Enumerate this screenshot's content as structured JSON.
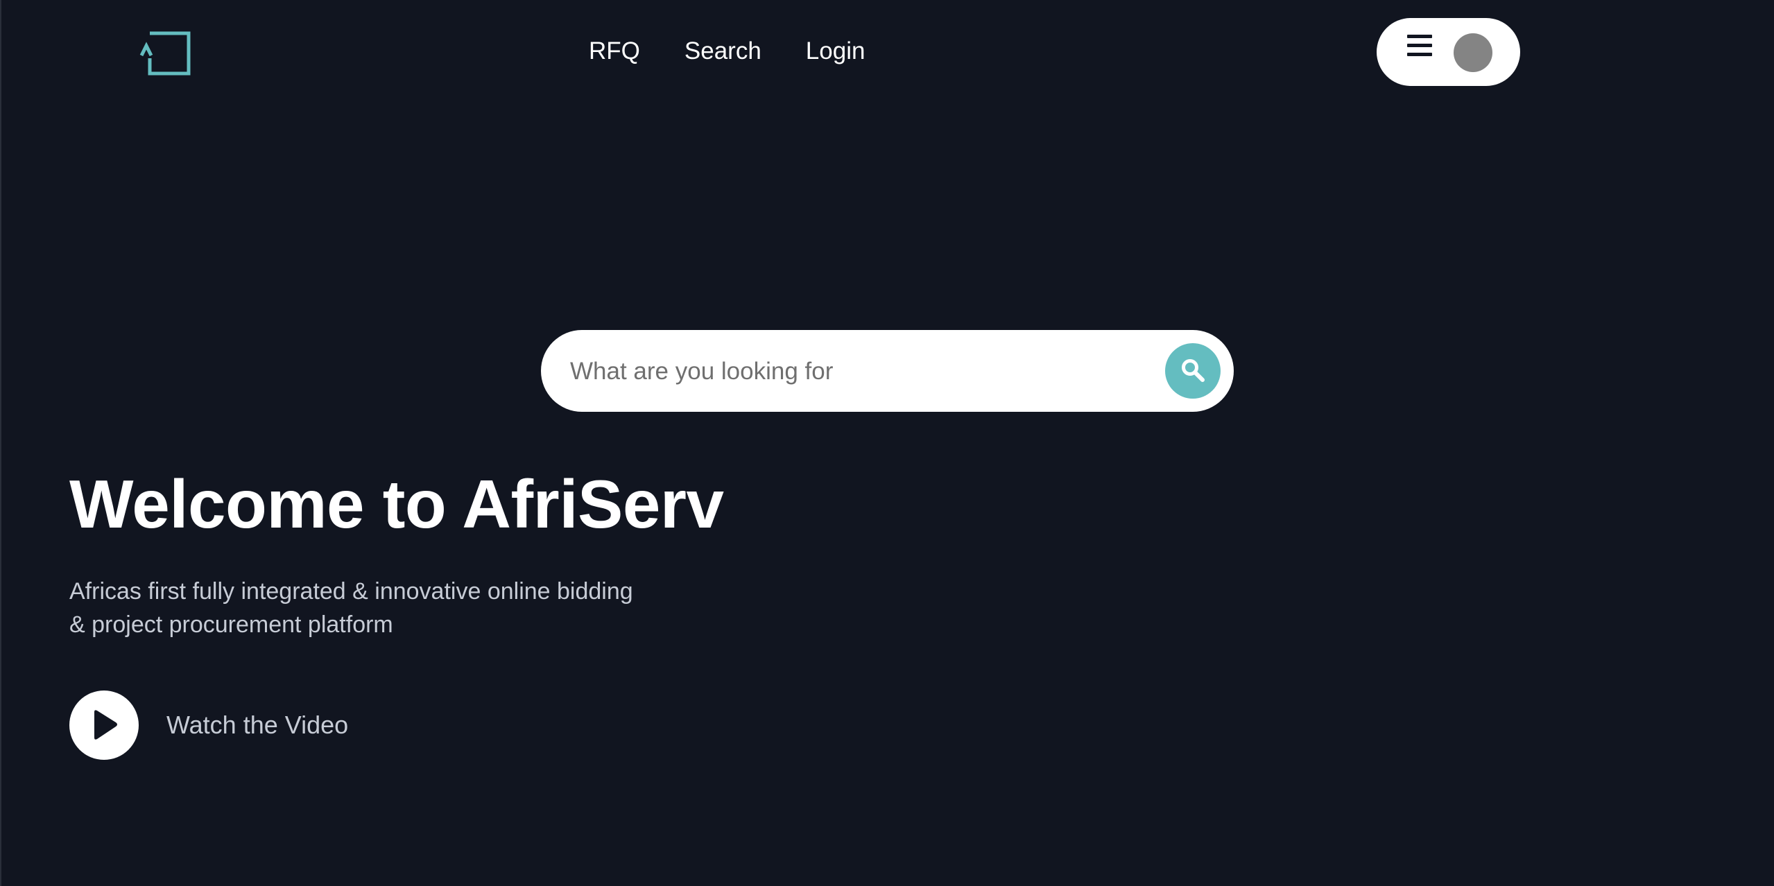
{
  "nav": {
    "links": [
      "RFQ",
      "Search",
      "Login"
    ]
  },
  "search": {
    "placeholder": "What are you looking for"
  },
  "hero": {
    "title": "Welcome to AfriServ",
    "subtitle_line1": "Africas first fully integrated & innovative online bidding",
    "subtitle_line2": "& project procurement platform",
    "watch_label": "Watch the Video"
  },
  "icons": {
    "logo": "afriserv-logo",
    "menu": "hamburger-icon",
    "avatar": "avatar",
    "search": "search-icon",
    "play": "play-icon"
  },
  "colors": {
    "background": "#111520",
    "accent": "#64bdc0",
    "text_primary": "#ffffff",
    "text_secondary": "#c7ccd6",
    "avatar_placeholder": "#848484"
  }
}
